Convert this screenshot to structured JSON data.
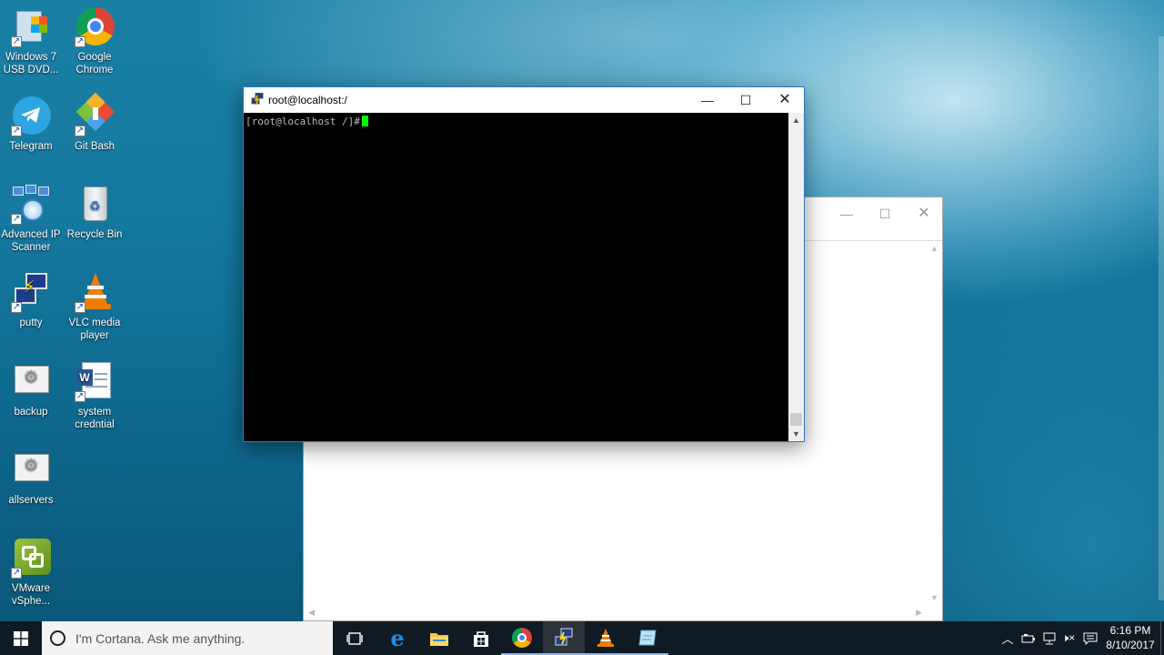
{
  "desktop": {
    "icons": [
      {
        "label": "Windows 7 USB DVD...",
        "icon": "windows7-usb-dvd-icon"
      },
      {
        "label": "Google Chrome",
        "icon": "chrome-icon"
      },
      {
        "label": "Telegram",
        "icon": "telegram-icon"
      },
      {
        "label": "Git Bash",
        "icon": "git-bash-icon"
      },
      {
        "label": "Advanced IP Scanner",
        "icon": "advanced-ip-scanner-icon"
      },
      {
        "label": "Recycle Bin",
        "icon": "recycle-bin-icon"
      },
      {
        "label": "putty",
        "icon": "putty-icon"
      },
      {
        "label": "VLC media player",
        "icon": "vlc-icon"
      },
      {
        "label": "backup",
        "icon": "putty-session-icon"
      },
      {
        "label": "system credntial",
        "icon": "document-icon"
      },
      {
        "label": "allservers",
        "icon": "putty-session-icon"
      },
      {
        "label": "VMware vSphe...",
        "icon": "vmware-icon"
      }
    ]
  },
  "putty_window": {
    "title": "root@localhost:/",
    "prompt": "[root@localhost /]#",
    "cursor_color": "#00ff00"
  },
  "taskbar": {
    "search_placeholder": "I'm Cortana. Ask me anything.",
    "clock_time": "6:16 PM",
    "clock_date": "8/10/2017",
    "accent": "#8ab6e6"
  }
}
